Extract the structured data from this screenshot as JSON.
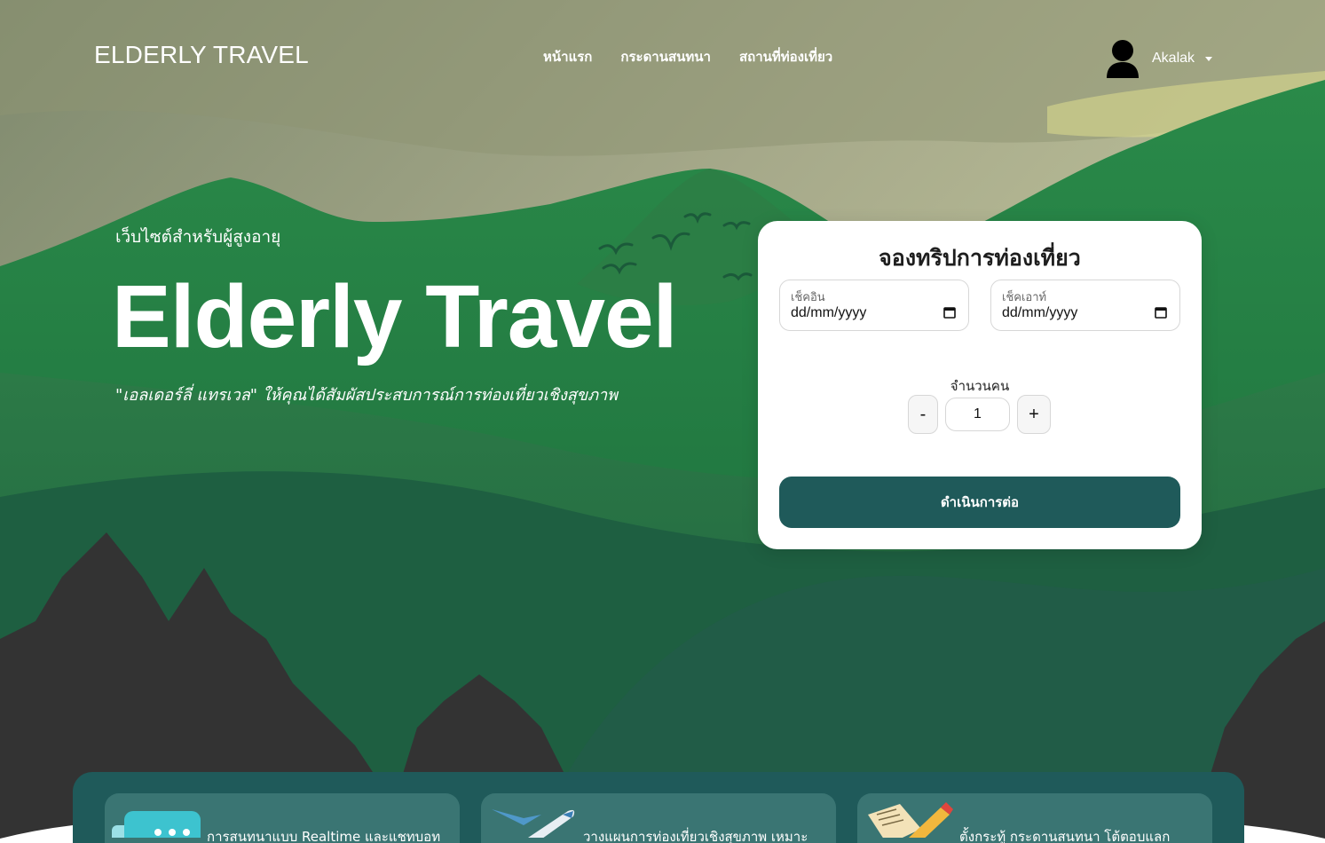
{
  "nav": {
    "brand": "ELDERLY TRAVEL",
    "links": [
      "หน้าแรก",
      "กระดานสนทนา",
      "สถานที่ท่องเที่ยว"
    ],
    "user_name": "Akalak"
  },
  "hero": {
    "tagline": "เว็บไซต์สำหรับผู้สูงอายุ",
    "title": "Elderly Travel",
    "quote": "\"เอลเดอร์ลี่ แทรเวล\" ให้คุณได้สัมผัสประสบการณ์การท่องเที่ยวเชิงสุขภาพ"
  },
  "booking": {
    "title": "จองทริปการท่องเที่ยว",
    "checkin_label": "เช็คอิน",
    "checkin_value": "dd/mm/yyyy",
    "checkout_label": "เช็คเอาท์",
    "checkout_value": "dd/mm/yyyy",
    "people_label": "จำนวนคน",
    "minus_label": "-",
    "plus_label": "+",
    "people_value": "1",
    "continue_label": "ดำเนินการต่อ"
  },
  "features": [
    {
      "icon": "chat-icon",
      "text": "การสนทนาแบบ Realtime และแชทบอท"
    },
    {
      "icon": "airplane-icon",
      "text": "วางแผนการท่องเที่ยวเชิงสุขภาพ เหมาะ"
    },
    {
      "icon": "notes-pencil-icon",
      "text": "ตั้งกระทู้ กระดานสนทนา โต้ตอบแลก"
    }
  ],
  "colors": {
    "primary": "#1f5a5a",
    "feature_card": "#3a7573",
    "forest_green": "#1f6b3c"
  }
}
